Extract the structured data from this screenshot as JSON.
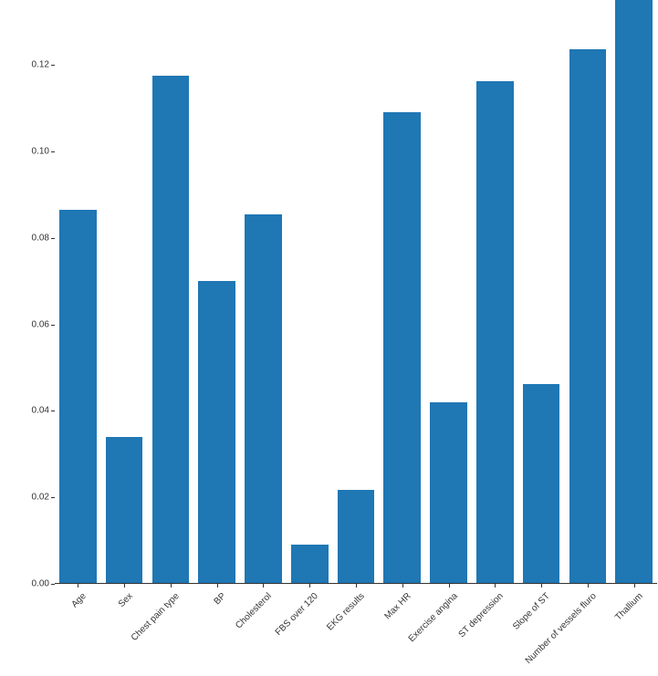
{
  "chart_data": {
    "type": "bar",
    "categories": [
      "Age",
      "Sex",
      "Chest pain type",
      "BP",
      "Cholesterol",
      "FBS over 120",
      "EKG results",
      "Max HR",
      "Exercise angina",
      "ST depression",
      "Slope of ST",
      "Number of vessels fluro",
      "Thallium"
    ],
    "values": [
      0.0865,
      0.034,
      0.1175,
      0.07,
      0.0855,
      0.009,
      0.0218,
      0.109,
      0.042,
      0.1163,
      0.0463,
      0.1237,
      0.135
    ],
    "title": "",
    "xlabel": "",
    "ylabel": "",
    "ylim": [
      0.0,
      0.135
    ],
    "yticks": [
      0.0,
      0.02,
      0.04,
      0.06,
      0.08,
      0.1,
      0.12
    ],
    "ytick_labels": [
      "0.00",
      "0.02",
      "0.04",
      "0.06",
      "0.08",
      "0.10",
      "0.12"
    ],
    "bar_color": "#1f77b4"
  }
}
